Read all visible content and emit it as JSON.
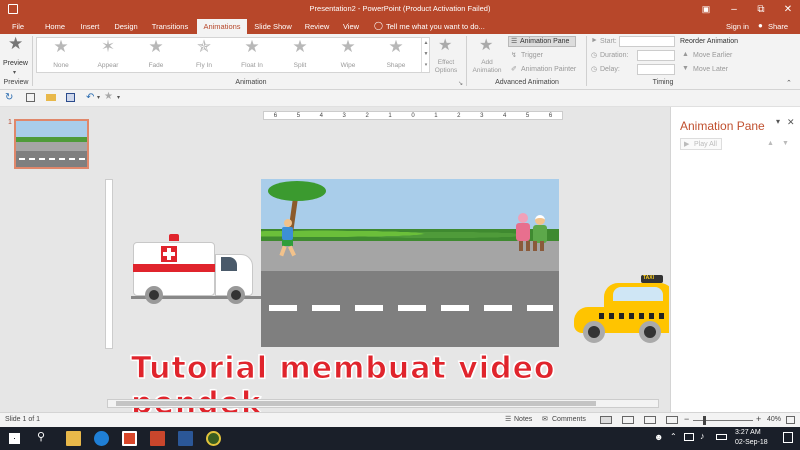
{
  "window": {
    "title": "Presentation2 - PowerPoint (Product Activation Failed)",
    "minimize": "–",
    "restore": "⧉",
    "close": "✕",
    "ribbon_toggle": "▣"
  },
  "tabs": [
    "File",
    "Home",
    "Insert",
    "Design",
    "Transitions",
    "Animations",
    "Slide Show",
    "Review",
    "View"
  ],
  "tell_me": "Tell me what you want to do...",
  "account": {
    "sign_in": "Sign in",
    "share": "Share"
  },
  "ribbon": {
    "preview_label": "Preview",
    "preview_group": "Preview",
    "animation_gallery": [
      "None",
      "Appear",
      "Fade",
      "Fly In",
      "Float In",
      "Split",
      "Wipe",
      "Shape"
    ],
    "effect_options": "Effect Options",
    "animation_group": "Animation",
    "add_animation": "Add Animation",
    "animation_pane": "Animation Pane",
    "trigger": "Trigger",
    "animation_painter": "Animation Painter",
    "advanced_group": "Advanced Animation",
    "start": "Start:",
    "duration": "Duration:",
    "delay": "Delay:",
    "reorder": "Reorder Animation",
    "move_earlier": "Move Earlier",
    "move_later": "Move Later",
    "timing_group": "Timing"
  },
  "slides": {
    "number": "1"
  },
  "ruler": {
    "marks": [
      "6",
      "5",
      "4",
      "3",
      "2",
      "1",
      "0",
      "1",
      "2",
      "3",
      "4",
      "5",
      "6"
    ]
  },
  "canvas": {
    "caption": "Tutorial membuat video pendek",
    "taxi_sign": "TAXI"
  },
  "pane": {
    "title": "Animation Pane",
    "play_all": "Play All"
  },
  "status": {
    "slide": "Slide 1 of 1",
    "notes": "Notes",
    "comments": "Comments",
    "zoom": "40%"
  },
  "taskbar": {
    "time": "3:27 AM",
    "date": "02-Sep-18"
  },
  "colors": {
    "accent": "#b7472a",
    "taskbar": "#1a1f29",
    "road": "#7f7f7f",
    "sky": "#a9cdea",
    "caption": "#e0242c"
  }
}
